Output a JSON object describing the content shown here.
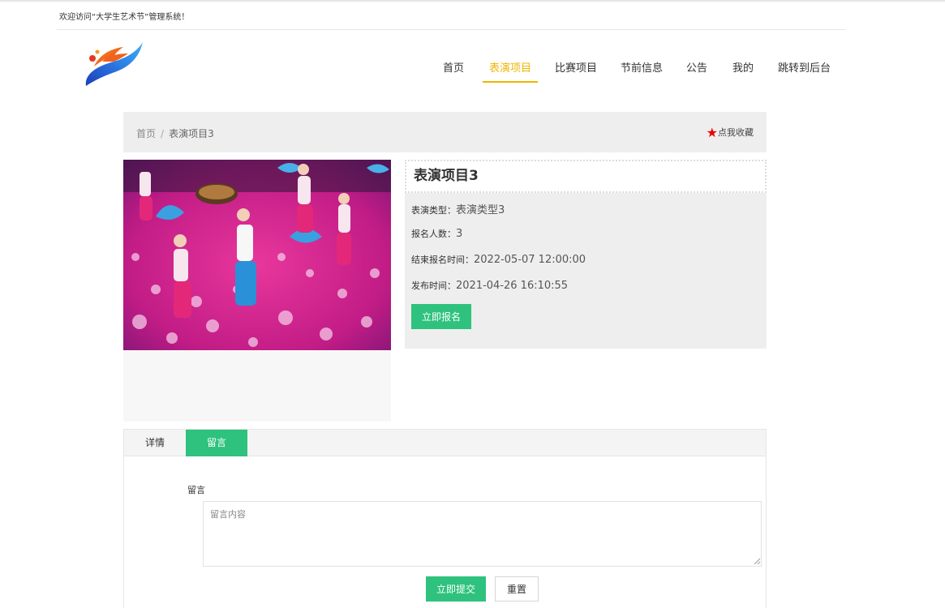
{
  "header": {
    "welcome": "欢迎访问“大学生艺术节”管理系统！"
  },
  "nav": {
    "items": [
      {
        "label": "首页"
      },
      {
        "label": "表演项目"
      },
      {
        "label": "比赛项目"
      },
      {
        "label": "节前信息"
      },
      {
        "label": "公告"
      },
      {
        "label": "我的"
      },
      {
        "label": "跳转到后台"
      }
    ],
    "active_index": 1
  },
  "breadcrumb": {
    "home": "首页",
    "separator": "/",
    "current": "表演项目3"
  },
  "favorite": {
    "icon": "star-icon",
    "label": "点我收藏",
    "icon_color": "#ee0000"
  },
  "detail": {
    "title": "表演项目3",
    "fields": [
      {
        "label": "表演类型：",
        "value": "表演类型3"
      },
      {
        "label": "报名人数：",
        "value": "3"
      },
      {
        "label": "结束报名时间：",
        "value": "2022-05-07 12:00:00"
      },
      {
        "label": "发布时间：",
        "value": "2021-04-26 16:10:55"
      }
    ],
    "signup_label": "立即报名"
  },
  "tabs": {
    "items": [
      {
        "label": "详情"
      },
      {
        "label": "留言"
      }
    ],
    "active_index": 1
  },
  "comment": {
    "label": "留言",
    "placeholder": "留言内容",
    "submit_label": "立即提交",
    "reset_label": "重置"
  },
  "colors": {
    "accent": "#2ec27e",
    "nav_active": "#f0b400"
  }
}
